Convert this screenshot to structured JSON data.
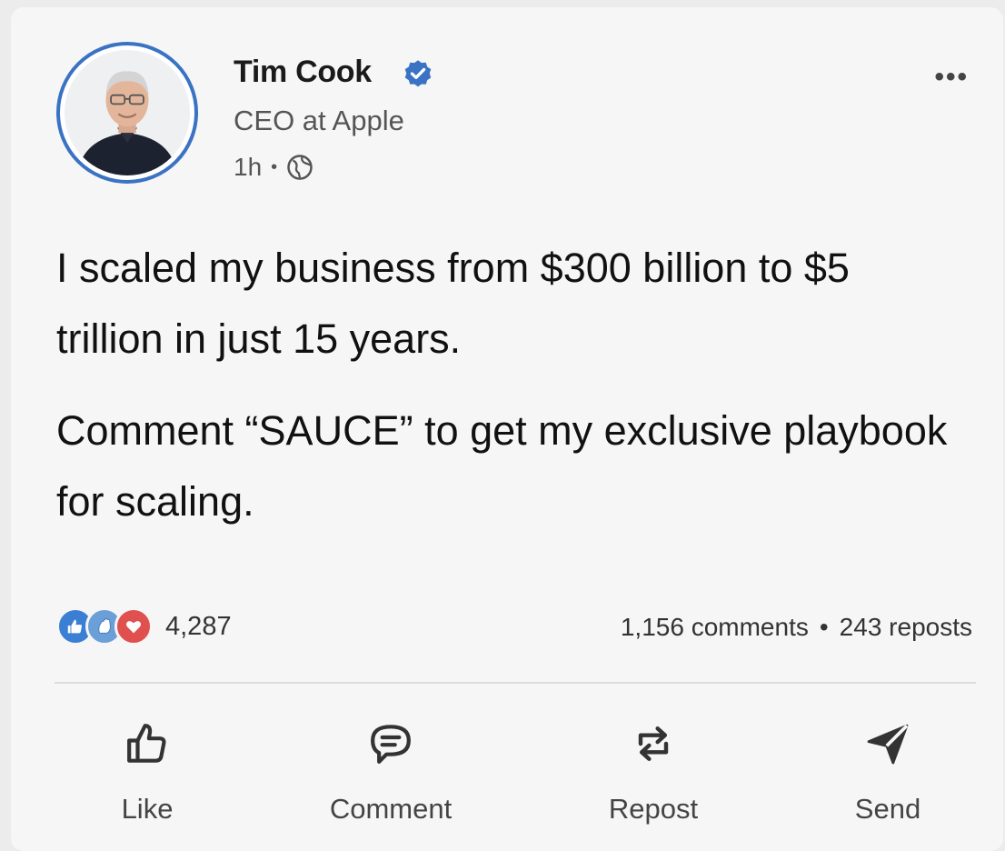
{
  "post": {
    "author": {
      "name": "Tim Cook",
      "headline": "CEO at Apple",
      "time": "1h",
      "separator": "•",
      "visibility_icon": "globe-icon",
      "verified_icon": "verified-badge-icon"
    },
    "more_label": "•••",
    "text": [
      "I scaled my business from $300 billion to $5 trillion in just 15 years.",
      "Comment “SAUCE” to get my exclusive playbook for scaling."
    ],
    "reactions": {
      "icons": [
        "like-reaction-icon",
        "celebrate-reaction-icon",
        "love-reaction-icon"
      ],
      "count": "4,287"
    },
    "engagement": {
      "comments": "1,156 comments",
      "separator": "•",
      "reposts": "243 reposts"
    },
    "actions": [
      {
        "label": "Like",
        "icon": "thumbs-up-icon"
      },
      {
        "label": "Comment",
        "icon": "comment-icon"
      },
      {
        "label": "Repost",
        "icon": "repost-icon"
      },
      {
        "label": "Send",
        "icon": "send-icon"
      }
    ],
    "colors": {
      "avatar_ring": "#3a72c4",
      "verified": "#3a72c4",
      "like": "#3b7fd4",
      "celebrate": "#6a9fd8",
      "love": "#e0504e"
    }
  }
}
